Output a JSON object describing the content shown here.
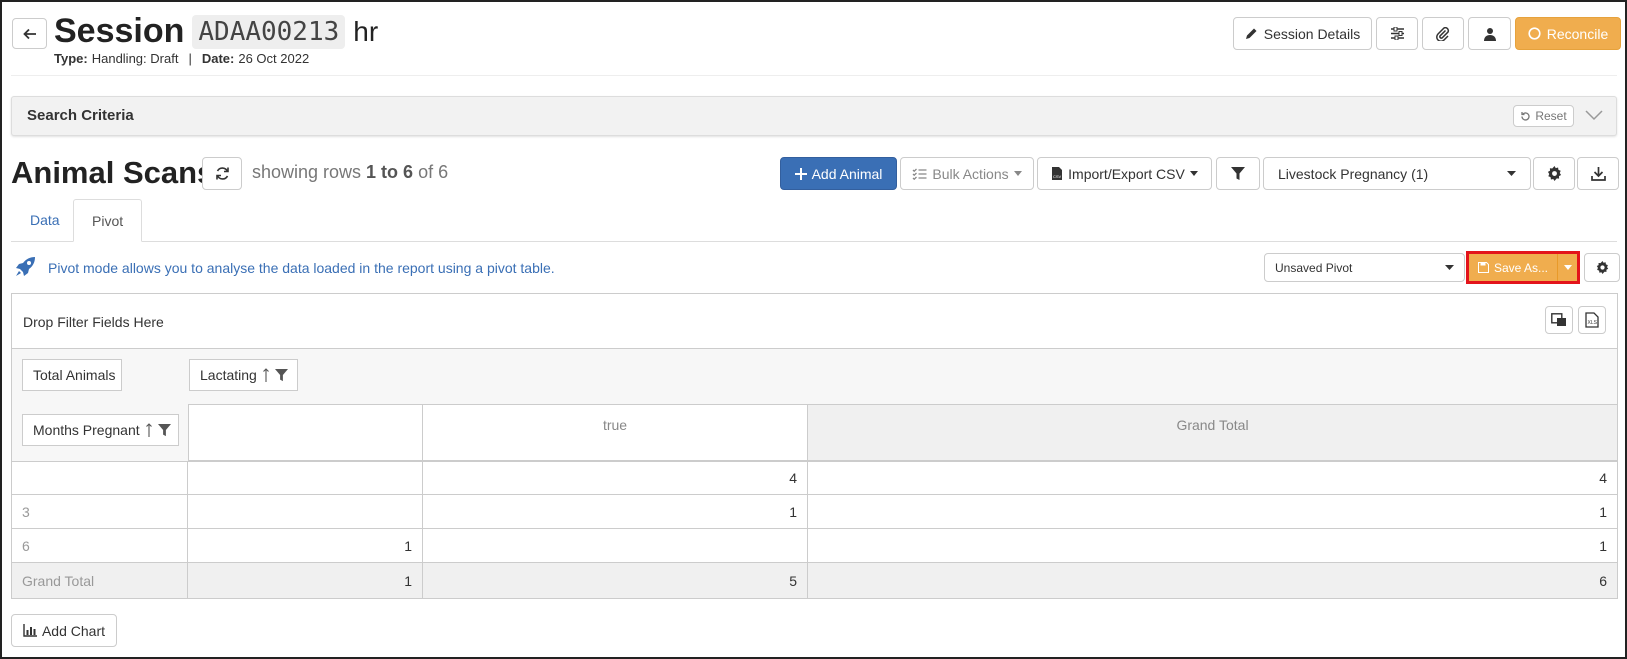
{
  "header": {
    "title": "Session",
    "code": "ADAA00213",
    "suffix": "hr",
    "type_label": "Type:",
    "type_value": "Handling: Draft",
    "separator": "|",
    "date_label": "Date:",
    "date_value": "26 Oct 2022",
    "session_details": "Session Details",
    "reconcile": "Reconcile"
  },
  "search": {
    "title": "Search Criteria",
    "reset": "Reset"
  },
  "scans": {
    "title": "Animal Scans",
    "showing_prefix": "showing rows",
    "showing_range": "1 to 6",
    "showing_suffix": "of 6",
    "add_animal": "Add Animal",
    "bulk_actions": "Bulk Actions",
    "import_export": "Import/Export CSV",
    "report_select": "Livestock Pregnancy (1)"
  },
  "tabs": [
    {
      "label": "Data"
    },
    {
      "label": "Pivot"
    }
  ],
  "pivot": {
    "info": "Pivot mode allows you to analyse the data loaded in the report using a pivot table.",
    "pivot_select": "Unsaved Pivot",
    "save_as": "Save As...",
    "drop_filter": "Drop Filter Fields Here",
    "value_field": "Total Animals",
    "column_field": "Lactating",
    "row_field": "Months Pregnant",
    "col_headers": [
      "",
      "true",
      "Grand Total"
    ],
    "rows": [
      {
        "label": "",
        "cells": [
          "",
          "4",
          "4"
        ]
      },
      {
        "label": "3",
        "cells": [
          "",
          "1",
          "1"
        ]
      },
      {
        "label": "6",
        "cells": [
          "1",
          "",
          "1"
        ]
      },
      {
        "label": "Grand Total",
        "cells": [
          "1",
          "5",
          "6"
        ]
      }
    ],
    "add_chart": "Add Chart"
  },
  "colors": {
    "primary": "#3a6fb5",
    "warning": "#f0ad4e",
    "highlight": "#e3141b",
    "link": "#3a6fb5"
  }
}
